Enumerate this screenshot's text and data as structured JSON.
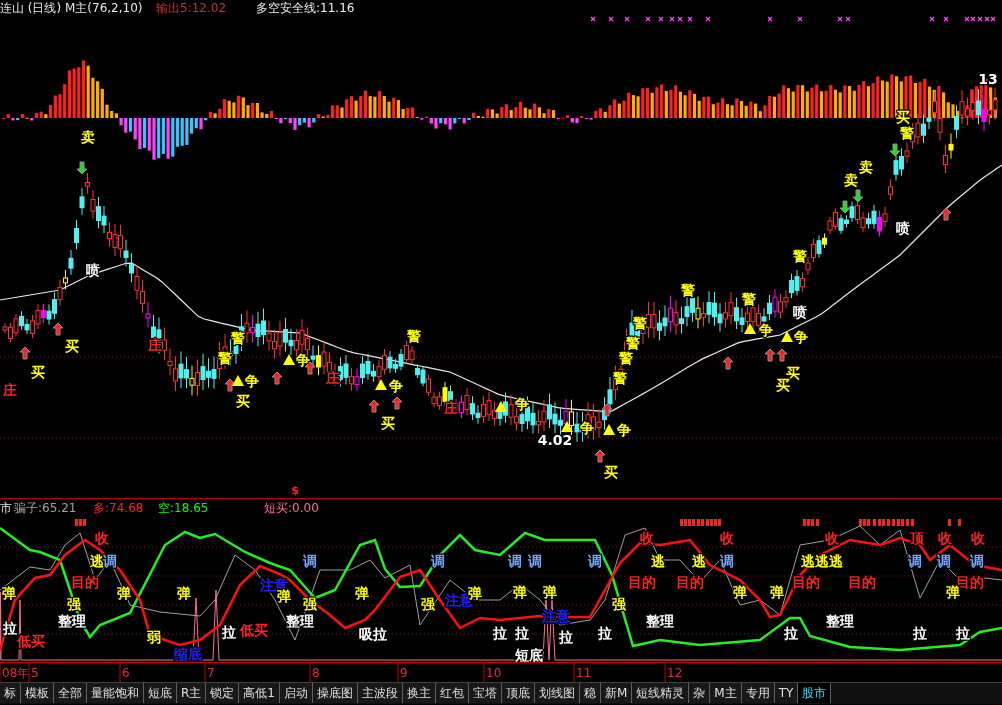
{
  "header": {
    "title": "连山 (日线) M主(76,2,10)",
    "output": "输出5:12.02",
    "safety_line": "多空安全线:11.16"
  },
  "price_chart": {
    "signal_marker": "$",
    "labels": [
      {
        "text": "卖",
        "color": "#ffff00"
      },
      {
        "text": "喷",
        "color": "#ffffff"
      },
      {
        "text": "买",
        "color": "#ffff00"
      },
      {
        "text": "买",
        "color": "#ffff00"
      },
      {
        "text": "庄",
        "color": "#ff2020"
      },
      {
        "text": "庄",
        "color": "#ff2020"
      },
      {
        "text": "警",
        "color": "#ffff00"
      },
      {
        "text": "警",
        "color": "#ffff00"
      },
      {
        "text": "争",
        "color": "#ffff00"
      },
      {
        "text": "买",
        "color": "#ffff00"
      },
      {
        "text": "争",
        "color": "#ffff00"
      },
      {
        "text": "庄",
        "color": "#ff2020"
      },
      {
        "text": "警",
        "color": "#ffff00"
      },
      {
        "text": "争",
        "color": "#ffff00"
      },
      {
        "text": "买",
        "color": "#ffff00"
      },
      {
        "text": "庄",
        "color": "#ff2020"
      },
      {
        "text": "争",
        "color": "#ffff00"
      },
      {
        "text": "4.02",
        "color": "#ffffff"
      },
      {
        "text": "争",
        "color": "#ffff00"
      },
      {
        "text": "争",
        "color": "#ffff00"
      },
      {
        "text": "买",
        "color": "#ffff00"
      },
      {
        "text": "警",
        "color": "#ffff00"
      },
      {
        "text": "警",
        "color": "#ffff00"
      },
      {
        "text": "警",
        "color": "#ffff00"
      },
      {
        "text": "警",
        "color": "#ffff00"
      },
      {
        "text": "警",
        "color": "#ffff00"
      },
      {
        "text": "警",
        "color": "#ffff00"
      },
      {
        "text": "争",
        "color": "#ffff00"
      },
      {
        "text": "争",
        "color": "#ffff00"
      },
      {
        "text": "买",
        "color": "#ffff00"
      },
      {
        "text": "买",
        "color": "#ffff00"
      },
      {
        "text": "警",
        "color": "#ffff00"
      },
      {
        "text": "喷",
        "color": "#ffffff"
      },
      {
        "text": "卖",
        "color": "#ffff00"
      },
      {
        "text": "卖",
        "color": "#ffff00"
      },
      {
        "text": "买",
        "color": "#ffff00"
      },
      {
        "text": "警",
        "color": "#ffff00"
      },
      {
        "text": "喷",
        "color": "#ffffff"
      },
      {
        "text": "13",
        "color": "#ffffff"
      }
    ]
  },
  "indicator": {
    "name": "市",
    "values": [
      {
        "label": "骗子:65.21",
        "color": "#a0a0a0"
      },
      {
        "label": "多:74.68",
        "color": "#ff2020"
      },
      {
        "label": "空:18.65",
        "color": "#00ff00"
      },
      {
        "label": "短买:0.00",
        "color": "#ff7090"
      }
    ],
    "labels": [
      {
        "text": "收",
        "color": "#ff2020"
      },
      {
        "text": "逃",
        "color": "#ffff00"
      },
      {
        "text": "调",
        "color": "#6fa8ff"
      },
      {
        "text": "目的",
        "color": "#ff2020"
      },
      {
        "text": "弹",
        "color": "#ffff00"
      },
      {
        "text": "强",
        "color": "#ffff00"
      },
      {
        "text": "整理",
        "color": "#ffffff"
      },
      {
        "text": "拉",
        "color": "#ffffff"
      },
      {
        "text": "低买",
        "color": "#ff2020"
      },
      {
        "text": "弹",
        "color": "#ffff00"
      },
      {
        "text": "弹",
        "color": "#ffff00"
      },
      {
        "text": "弱",
        "color": "#ffff00"
      },
      {
        "text": "缩底",
        "color": "#2020ff"
      },
      {
        "text": "拉",
        "color": "#ffffff"
      },
      {
        "text": "低买",
        "color": "#ff2020"
      },
      {
        "text": "注意",
        "color": "#2020ff"
      },
      {
        "text": "弹",
        "color": "#ffff00"
      },
      {
        "text": "调",
        "color": "#6fa8ff"
      },
      {
        "text": "强",
        "color": "#ffff00"
      },
      {
        "text": "整理",
        "color": "#ffffff"
      },
      {
        "text": "吸拉",
        "color": "#ffffff"
      },
      {
        "text": "弹",
        "color": "#ffff00"
      },
      {
        "text": "调",
        "color": "#6fa8ff"
      },
      {
        "text": "强",
        "color": "#ffff00"
      },
      {
        "text": "注意",
        "color": "#2020ff"
      },
      {
        "text": "弹",
        "color": "#ffff00"
      },
      {
        "text": "调",
        "color": "#6fa8ff"
      },
      {
        "text": "调",
        "color": "#6fa8ff"
      },
      {
        "text": "调",
        "color": "#6fa8ff"
      },
      {
        "text": "弹",
        "color": "#ffff00"
      },
      {
        "text": "弹",
        "color": "#ffff00"
      },
      {
        "text": "强",
        "color": "#ffff00"
      },
      {
        "text": "拉",
        "color": "#ffffff"
      },
      {
        "text": "拉",
        "color": "#ffffff"
      },
      {
        "text": "拉",
        "color": "#ffffff"
      },
      {
        "text": "拉",
        "color": "#ffffff"
      },
      {
        "text": "短底",
        "color": "#ffffff"
      },
      {
        "text": "注意",
        "color": "#2020ff"
      },
      {
        "text": "收",
        "color": "#ff2020"
      },
      {
        "text": "收",
        "color": "#ff2020"
      },
      {
        "text": "逃",
        "color": "#ffff00"
      },
      {
        "text": "逃",
        "color": "#ffff00"
      },
      {
        "text": "调",
        "color": "#6fa8ff"
      },
      {
        "text": "目的",
        "color": "#ff2020"
      },
      {
        "text": "目的",
        "color": "#ff2020"
      },
      {
        "text": "弹",
        "color": "#ffff00"
      },
      {
        "text": "弹",
        "color": "#ffff00"
      },
      {
        "text": "整理",
        "color": "#ffffff"
      },
      {
        "text": "逃逃逃",
        "color": "#ffff00"
      },
      {
        "text": "收",
        "color": "#ff2020"
      },
      {
        "text": "目的",
        "color": "#ff2020"
      },
      {
        "text": "目的",
        "color": "#ff2020"
      },
      {
        "text": "拉",
        "color": "#ffffff"
      },
      {
        "text": "整理",
        "color": "#ffffff"
      },
      {
        "text": "顶",
        "color": "#ff2020"
      },
      {
        "text": "收",
        "color": "#ff2020"
      },
      {
        "text": "收",
        "color": "#ff2020"
      },
      {
        "text": "调",
        "color": "#6fa8ff"
      },
      {
        "text": "调",
        "color": "#6fa8ff"
      },
      {
        "text": "调",
        "color": "#6fa8ff"
      },
      {
        "text": "目的",
        "color": "#ff2020"
      },
      {
        "text": "弹",
        "color": "#ffff00"
      },
      {
        "text": "拉",
        "color": "#ffffff"
      },
      {
        "text": "拉",
        "color": "#ffffff"
      }
    ]
  },
  "time_axis": [
    "08年",
    "5",
    "6",
    "7",
    "8",
    "9",
    "10",
    "11",
    "12"
  ],
  "tabs": [
    {
      "label": "标",
      "selected": false
    },
    {
      "label": "模板",
      "selected": false
    },
    {
      "label": "全部",
      "selected": false
    },
    {
      "label": "量能饱和",
      "selected": false
    },
    {
      "label": "短底",
      "selected": false
    },
    {
      "label": "R主",
      "selected": false
    },
    {
      "label": "锁定",
      "selected": false
    },
    {
      "label": "高低1",
      "selected": false
    },
    {
      "label": "启动",
      "selected": false
    },
    {
      "label": "操底图",
      "selected": false
    },
    {
      "label": "主波段",
      "selected": false
    },
    {
      "label": "换主",
      "selected": false
    },
    {
      "label": "红包",
      "selected": false
    },
    {
      "label": "宝塔",
      "selected": false
    },
    {
      "label": "顶底",
      "selected": false
    },
    {
      "label": "划线图",
      "selected": false
    },
    {
      "label": "稳",
      "selected": false
    },
    {
      "label": "新M",
      "selected": false
    },
    {
      "label": "短线精灵",
      "selected": false
    },
    {
      "label": "杂",
      "selected": false
    },
    {
      "label": "M主",
      "selected": false
    },
    {
      "label": "专用",
      "selected": false
    },
    {
      "label": "TY",
      "selected": false
    },
    {
      "label": "股市",
      "selected": true
    }
  ]
}
